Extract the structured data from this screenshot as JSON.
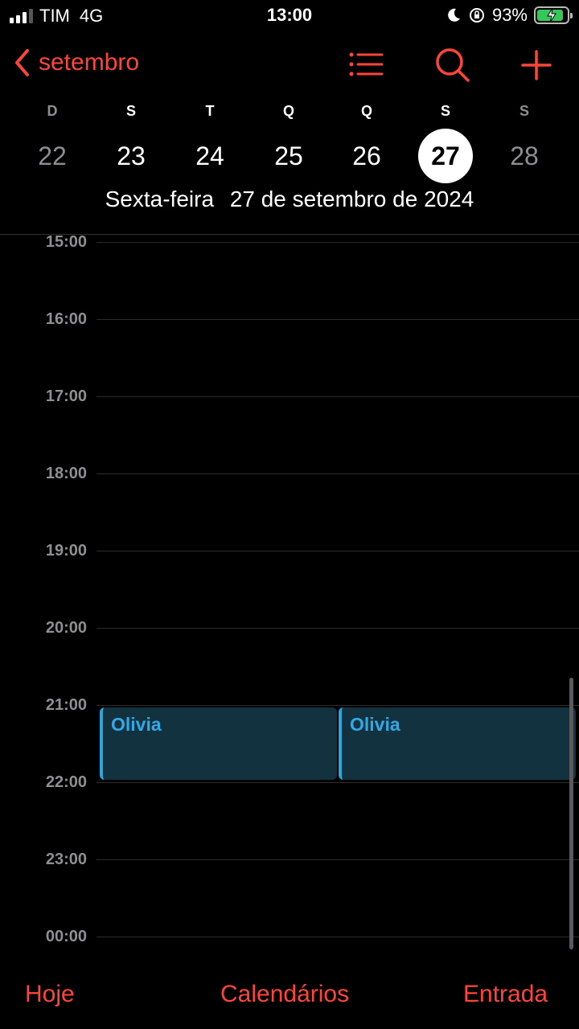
{
  "status_bar": {
    "carrier": "TIM",
    "network": "4G",
    "time": "13:00",
    "battery_percent": "93%",
    "icons": [
      "signal-icon",
      "moon-icon",
      "rotation-lock-icon",
      "battery-charging-icon"
    ]
  },
  "nav": {
    "back_label": "setembro",
    "icons": [
      "list-icon",
      "search-icon",
      "plus-icon"
    ]
  },
  "week": {
    "letters": [
      "D",
      "S",
      "T",
      "Q",
      "Q",
      "S",
      "S"
    ],
    "days": [
      "22",
      "23",
      "24",
      "25",
      "26",
      "27",
      "28"
    ],
    "selected_index": 5
  },
  "date_title": {
    "weekday": "Sexta-feira",
    "date": "27 de setembro de 2024"
  },
  "timeline": {
    "hours": [
      "15:00",
      "16:00",
      "17:00",
      "18:00",
      "19:00",
      "20:00",
      "21:00",
      "22:00",
      "23:00",
      "00:00"
    ],
    "events": [
      {
        "title": "Olivia",
        "start": "21:00",
        "end": "22:00"
      },
      {
        "title": "Olivia",
        "start": "21:00",
        "end": "22:00"
      }
    ]
  },
  "tab_bar": {
    "today": "Hoje",
    "calendars": "Calendários",
    "inbox": "Entrada"
  },
  "colors": {
    "accent": "#ff453a",
    "event_bg": "#12323f",
    "event_text": "#32a8e6",
    "background": "#000000"
  }
}
